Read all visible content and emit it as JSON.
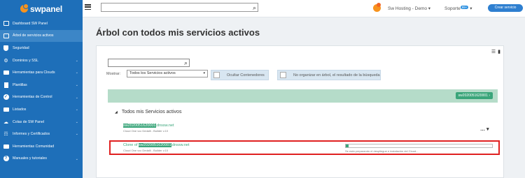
{
  "app": {
    "logo_text": "swpanel"
  },
  "sidebar": {
    "items": [
      {
        "label": "Dashboard SW Panel",
        "icon": "dashboard-icon",
        "chevron": false,
        "active": false
      },
      {
        "label": "Árbol de servicios activos",
        "icon": "tree-icon",
        "chevron": false,
        "active": true
      },
      {
        "label": "Seguridad",
        "icon": "shield-icon",
        "chevron": false,
        "active": false
      },
      {
        "label": "Dominios y SSL",
        "icon": "gear-icon",
        "chevron": true,
        "active": false
      },
      {
        "label": "Herramientas para Clouds",
        "icon": "toolbox-icon",
        "chevron": true,
        "active": false
      },
      {
        "label": "Plantillas",
        "icon": "document-icon",
        "chevron": true,
        "active": false
      },
      {
        "label": "Herramientas de Control",
        "icon": "check-icon",
        "chevron": true,
        "active": false
      },
      {
        "label": "Listados",
        "icon": "list-icon",
        "chevron": true,
        "active": false
      },
      {
        "label": "Colas de SW Panel",
        "icon": "queue-icon",
        "chevron": true,
        "active": false
      },
      {
        "label": "Informes y Certificados",
        "icon": "report-icon",
        "chevron": true,
        "active": false
      },
      {
        "label": "Herramientas Comunidad",
        "icon": "toolbox-icon",
        "chevron": false,
        "active": false
      },
      {
        "label": "Manuales y tutoriales",
        "icon": "help-icon",
        "chevron": true,
        "active": false
      }
    ]
  },
  "topbar": {
    "search_placeholder": "",
    "account": "Sw Hosting - Demo",
    "support": "Soporte",
    "support_badge": "99+",
    "create_button": "Crear servicio"
  },
  "page": {
    "title": "Árbol con todos mis servicios activos",
    "show_label": "Mostrar:",
    "filter_value": "Todos los Servicios activos",
    "toggle_containers": "Ocultar Contenedores",
    "toggle_tree": "No organizar en árbol, el resultado de la búsqueda",
    "banner_tag": "sw2020051620001",
    "tree_root": "Todos mis Servicios activos",
    "service": {
      "id": "sw2020051620001",
      "suffix": ".dnssw.net",
      "sub": "Cloud One vcc Dedalli - Builder v.10"
    },
    "clone": {
      "prefix": "Clone of ",
      "id": "sw2020051620001",
      "suffix": ".dnssw.net",
      "sub": "Cloud One vcc Dedalli - Builder v.10",
      "progress": 0.02,
      "status": "Se está preparando el despliegue e instalación del Cloud..."
    }
  }
}
